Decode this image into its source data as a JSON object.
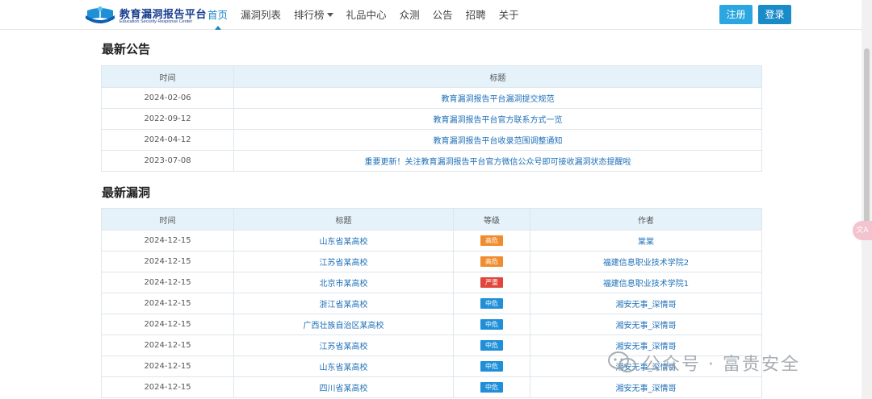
{
  "brand": {
    "title": "教育漏洞报告平台",
    "subtitle": "Education Security Response Center"
  },
  "nav": {
    "items": [
      {
        "label": "首页",
        "active": true
      },
      {
        "label": "漏洞列表"
      },
      {
        "label": "排行榜",
        "dropdown": true
      },
      {
        "label": "礼品中心"
      },
      {
        "label": "众测"
      },
      {
        "label": "公告"
      },
      {
        "label": "招聘"
      },
      {
        "label": "关于"
      }
    ]
  },
  "auth": {
    "register": "注册",
    "login": "登录"
  },
  "announcements": {
    "title": "最新公告",
    "headers": [
      "时间",
      "标题"
    ],
    "rows": [
      {
        "date": "2024-02-06",
        "title": "教育漏洞报告平台漏洞提交规范"
      },
      {
        "date": "2022-09-12",
        "title": "教育漏洞报告平台官方联系方式一览"
      },
      {
        "date": "2024-04-12",
        "title": "教育漏洞报告平台收录范围调整通知"
      },
      {
        "date": "2023-07-08",
        "title": "重要更新！关注教育漏洞报告平台官方微信公众号即可接收漏洞状态提醒啦"
      }
    ]
  },
  "vulns": {
    "title": "最新漏洞",
    "headers": [
      "时间",
      "标题",
      "等级",
      "作者"
    ],
    "rows": [
      {
        "date": "2024-12-15",
        "title": "山东省某高校",
        "level": "高危",
        "author": "棠棠"
      },
      {
        "date": "2024-12-15",
        "title": "江苏省某高校",
        "level": "高危",
        "author": "福建信息职业技术学院2"
      },
      {
        "date": "2024-12-15",
        "title": "北京市某高校",
        "level": "严重",
        "author": "福建信息职业技术学院1"
      },
      {
        "date": "2024-12-15",
        "title": "浙江省某高校",
        "level": "中危",
        "author": "湘安无事_深情哥"
      },
      {
        "date": "2024-12-15",
        "title": "广西壮族自治区某高校",
        "level": "中危",
        "author": "湘安无事_深情哥"
      },
      {
        "date": "2024-12-15",
        "title": "江苏省某高校",
        "level": "中危",
        "author": "湘安无事_深情哥"
      },
      {
        "date": "2024-12-15",
        "title": "山东省某高校",
        "level": "中危",
        "author": "湘安无事_深情哥"
      },
      {
        "date": "2024-12-15",
        "title": "四川省某高校",
        "level": "中危",
        "author": "湘安无事_深情哥"
      }
    ]
  },
  "level_colors": {
    "高危": "#f08c2e",
    "严重": "#e0463c",
    "中危": "#1f8fd8"
  },
  "watermark": {
    "text": "公众号 · 富贵安全"
  }
}
